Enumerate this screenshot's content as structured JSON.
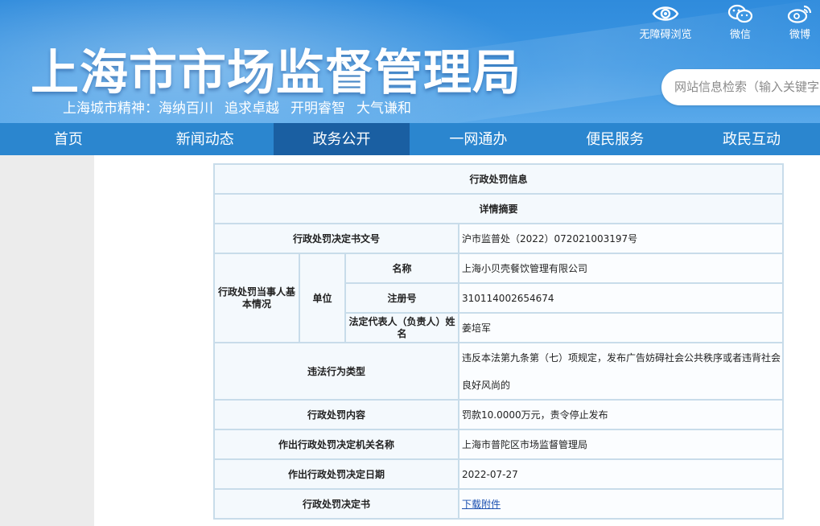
{
  "header": {
    "title": "上海市市场监督管理局",
    "spirit_label": "上海城市精神：",
    "spirit_phrases": [
      "海纳百川",
      "追求卓越",
      "开明睿智",
      "大气谦和"
    ],
    "tools": [
      {
        "icon": "eye-icon",
        "label": "无障碍浏览"
      },
      {
        "icon": "wechat-icon",
        "label": "微信"
      },
      {
        "icon": "weibo-icon",
        "label": "微博"
      }
    ],
    "search_placeholder": "网站信息检索（输入关键字"
  },
  "nav": {
    "items": [
      "首页",
      "新闻动态",
      "政务公开",
      "一网通办",
      "便民服务",
      "政民互动"
    ],
    "active": "政务公开"
  },
  "table": {
    "title": "行政处罚信息",
    "subtitle": "详情摘要",
    "doc_no_label": "行政处罚决定书文号",
    "doc_no": "沪市监普处（2022）072021003197号",
    "party_label": "行政处罚当事人基本情况",
    "unit_label": "单位",
    "name_label": "名称",
    "name": "上海小贝壳餐饮管理有限公司",
    "reg_label": "注册号",
    "reg_no": "310114002654674",
    "rep_label": "法定代表人（负责人）姓名",
    "rep_name": "姜培军",
    "violation_label": "违法行为类型",
    "violation": "违反本法第九条第（七）项规定，发布广告妨碍社会公共秩序或者违背社会良好风尚的",
    "content_label": "行政处罚内容",
    "content": "罚款10.0000万元，责令停止发布",
    "authority_label": "作出行政处罚决定机关名称",
    "authority": "上海市普陀区市场监督管理局",
    "date_label": "作出行政处罚决定日期",
    "date": "2022-07-27",
    "decision_label": "行政处罚决定书",
    "download_label": "下载附件"
  },
  "colors": {
    "header_blue": "#3d97e3",
    "nav_blue": "#2b86cf",
    "nav_active": "#1a5fa2",
    "table_border": "#c8dcea",
    "table_bg": "#f4f9fd",
    "link": "#1a4fb0"
  }
}
